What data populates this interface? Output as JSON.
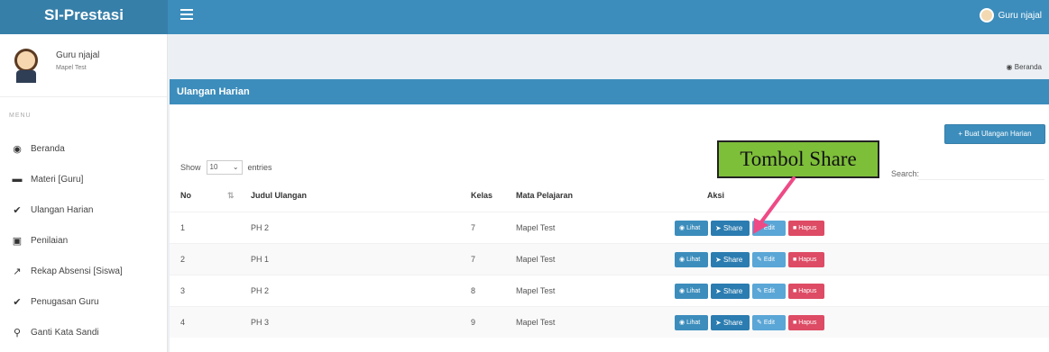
{
  "app": {
    "title": "SI-Prestasi"
  },
  "topbar": {
    "user_name": "Guru njajal"
  },
  "sidebar": {
    "user_name": "Guru njajal",
    "user_sub": "Mapel Test",
    "menu_header": "MENU",
    "items": [
      {
        "label": "Beranda",
        "icon": "dashboard-icon"
      },
      {
        "label": "Materi [Guru]",
        "icon": "folder-icon"
      },
      {
        "label": "Ulangan Harian",
        "icon": "check-icon"
      },
      {
        "label": "Penilaian",
        "icon": "book-icon"
      },
      {
        "label": "Rekap Absensi [Siswa]",
        "icon": "chart-icon"
      },
      {
        "label": "Penugasan Guru",
        "icon": "check-icon"
      },
      {
        "label": "Ganti Kata Sandi",
        "icon": "key-icon"
      }
    ]
  },
  "breadcrumb": {
    "label": "Beranda"
  },
  "box": {
    "title": "Ulangan Harian",
    "create_label": "+ Buat Ulangan Harian",
    "show_label": "Show",
    "entries_value": "10",
    "entries_label": "entries",
    "search_label": "Search:",
    "search_value": ""
  },
  "table": {
    "headers": {
      "no": "No",
      "judul": "Judul Ulangan",
      "kelas": "Kelas",
      "mapel": "Mata Pelajaran",
      "aksi": "Aksi"
    },
    "rows": [
      {
        "no": "1",
        "judul": "PH 2",
        "kelas": "7",
        "mapel": "Mapel Test"
      },
      {
        "no": "2",
        "judul": "PH 1",
        "kelas": "7",
        "mapel": "Mapel Test"
      },
      {
        "no": "3",
        "judul": "PH 2",
        "kelas": "8",
        "mapel": "Mapel Test"
      },
      {
        "no": "4",
        "judul": "PH 3",
        "kelas": "9",
        "mapel": "Mapel Test"
      }
    ],
    "actions": {
      "lihat": "Lihat",
      "share": "Share",
      "edit": "Edit",
      "hapus": "Hapus"
    }
  },
  "annotation": {
    "label": "Tombol Share"
  },
  "colors": {
    "primary": "#3c8dbc",
    "danger": "#dd4b64",
    "callout": "#7ebf3a",
    "arrow": "#ee4a86"
  }
}
